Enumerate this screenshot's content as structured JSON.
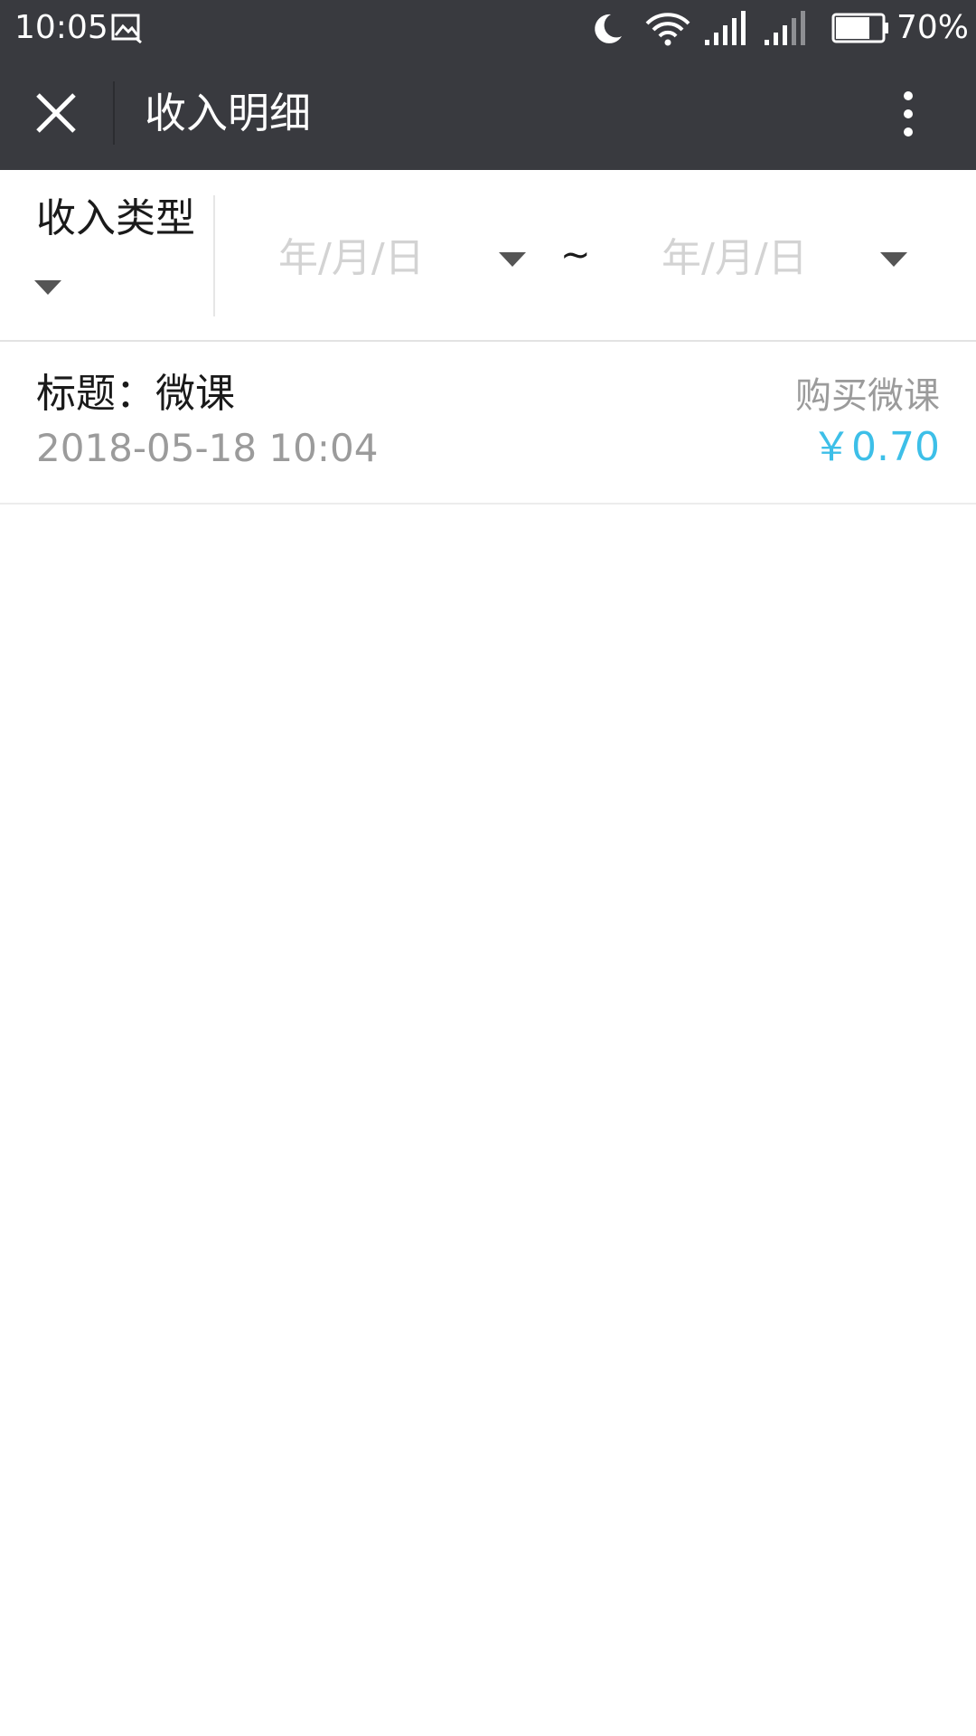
{
  "status_bar": {
    "time": "10:05",
    "battery": "70%",
    "icons": [
      "image-icon",
      "moon-icon",
      "wifi-icon",
      "signal-icon",
      "signal-icon",
      "battery-icon"
    ]
  },
  "header": {
    "title": "收入明细",
    "background": "#393a3f"
  },
  "filters": {
    "type_label": "收入类型",
    "start_date_placeholder": "年/月/日",
    "separator": "~",
    "end_date_placeholder": "年/月/日"
  },
  "records": [
    {
      "title": "标题：微课",
      "time": "2018-05-18 10:04",
      "type": "购买微课",
      "amount": "￥0.70"
    }
  ],
  "colors": {
    "amount": "#3dbfe8",
    "secondary_text": "#9b9b9b",
    "placeholder": "#d3d3d3"
  }
}
